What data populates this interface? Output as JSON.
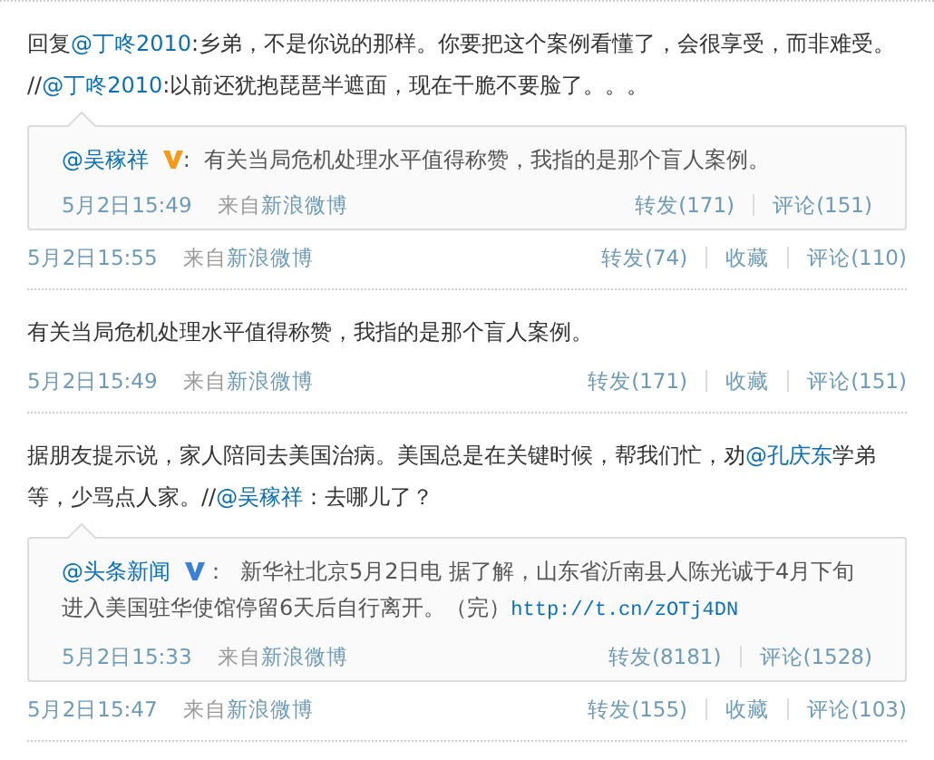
{
  "posts": [
    {
      "text": [
        {
          "kind": "text",
          "text": "回复"
        },
        {
          "kind": "mention",
          "text": "@丁咚2010"
        },
        {
          "kind": "text",
          "text": ":乡弟，不是你说的那样。你要把这个案例看懂了，会很享受，而非难受。 //"
        },
        {
          "kind": "mention",
          "text": "@丁咚2010"
        },
        {
          "kind": "text",
          "text": ":以前还犹抱琵琶半遮面，现在干脆不要脸了。。。"
        }
      ],
      "quote": {
        "author": "@吴稼祥",
        "color": "#f59a1b",
        "colon": ":",
        "text": [
          {
            "kind": "text",
            "text": "有关当局危机处理水平值得称赞，我指的是那个盲人案例。"
          }
        ],
        "time": "5月2日15:49",
        "source_prefix": "来自",
        "source": "新浪微博",
        "actions": [
          "转发(171)",
          "评论(151)"
        ]
      },
      "time": "5月2日15:55",
      "source_prefix": "来自",
      "source": "新浪微博",
      "actions": [
        "转发(74)",
        "收藏",
        "评论(110)"
      ]
    },
    {
      "text": [
        {
          "kind": "text",
          "text": "有关当局危机处理水平值得称赞，我指的是那个盲人案例。"
        }
      ],
      "time": "5月2日15:49",
      "source_prefix": "来自",
      "source": "新浪微博",
      "actions": [
        "转发(171)",
        "收藏",
        "评论(151)"
      ]
    },
    {
      "text": [
        {
          "kind": "text",
          "text": "据朋友提示说，家人陪同去美国治病。美国总是在关键时候，帮我们忙，劝"
        },
        {
          "kind": "mention",
          "text": "@孔庆东"
        },
        {
          "kind": "text",
          "text": "学弟等，少骂点人家。//"
        },
        {
          "kind": "mention",
          "text": "@吴稼祥"
        },
        {
          "kind": "text",
          "text": "：去哪儿了？"
        }
      ],
      "quote": {
        "author": "@头条新闻",
        "color": "#3b7fd6",
        "colon": "：",
        "text": [
          {
            "kind": "text",
            "text": "新华社北京5月2日电 据了解，山东省沂南县人陈光诚于4月下旬进入美国驻华使馆停留6天后自行离开。（完）"
          },
          {
            "kind": "url",
            "text": "http://t.cn/zOTj4DN"
          }
        ],
        "time": "5月2日15:33",
        "source_prefix": "来自",
        "source": "新浪微博",
        "actions": [
          "转发(8181)",
          "评论(1528)"
        ]
      },
      "time": "5月2日15:47",
      "source_prefix": "来自",
      "source": "新浪微博",
      "actions": [
        "转发(155)",
        "收藏",
        "评论(103)"
      ]
    }
  ]
}
